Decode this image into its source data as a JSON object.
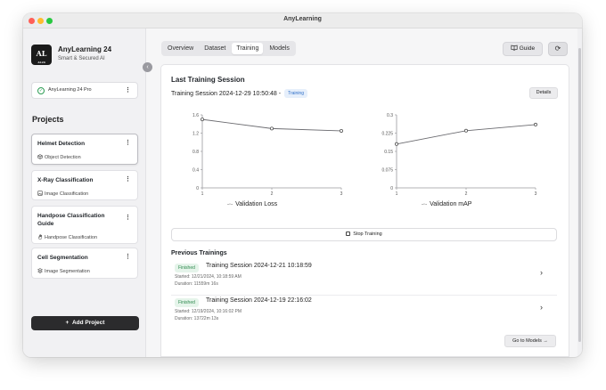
{
  "window": {
    "title": "AnyLearning"
  },
  "app": {
    "name": "AnyLearning 24",
    "tagline": "Smart & Secured AI",
    "logo_text": "AL",
    "logo_sub": "AL24"
  },
  "plan": {
    "label": "AnyLearning 24 Pro"
  },
  "sidebar": {
    "projects_title": "Projects",
    "projects": [
      {
        "name": "Helmet Detection",
        "type": "Object Detection",
        "icon": "cube-icon",
        "active": true
      },
      {
        "name": "X-Ray Classification",
        "type": "Image Classification",
        "icon": "image-icon",
        "active": false
      },
      {
        "name": "Handpose Classification Guide",
        "type": "Handpose Classification",
        "icon": "hand-icon",
        "active": false
      },
      {
        "name": "Cell Segmentation",
        "type": "Image Segmentation",
        "icon": "layers-icon",
        "active": false
      }
    ],
    "add_project_label": "Add Project"
  },
  "tabs": [
    {
      "label": "Overview",
      "active": false
    },
    {
      "label": "Dataset",
      "active": false
    },
    {
      "label": "Training",
      "active": true
    },
    {
      "label": "Models",
      "active": false
    }
  ],
  "toolbar": {
    "guide_label": "Guide"
  },
  "last_session": {
    "section_title": "Last Training Session",
    "session_label": "Training Session 2024-12-29 10:50:48 -",
    "status": "Training",
    "details_label": "Details"
  },
  "chart_data": [
    {
      "type": "line",
      "x": [
        1,
        2,
        3
      ],
      "values": [
        1.5,
        1.3,
        1.25
      ],
      "xticks": [
        "1",
        "2",
        "3"
      ],
      "yticks": [
        "0",
        "0.4",
        "0.8",
        "1.2",
        "1.6"
      ],
      "ylim": [
        0,
        1.6
      ],
      "legend": "Validation Loss"
    },
    {
      "type": "line",
      "x": [
        1,
        2,
        3
      ],
      "values": [
        0.18,
        0.235,
        0.26
      ],
      "xticks": [
        "1",
        "2",
        "3"
      ],
      "yticks": [
        "0",
        "0.075",
        "0.15",
        "0.225",
        "0.3"
      ],
      "ylim": [
        0,
        0.3
      ],
      "legend": "Validation mAP"
    }
  ],
  "stop_training_label": "Stop Training",
  "previous": {
    "title": "Previous Trainings",
    "items": [
      {
        "status": "Finished",
        "name": "Training Session 2024-12-21 10:18:59",
        "started": "Started: 12/21/2024, 10:18:59 AM",
        "duration": "Duration: 11559m 16s"
      },
      {
        "status": "Finished",
        "name": "Training Session 2024-12-19 22:16:02",
        "started": "Started: 12/19/2024, 10:16:02 PM",
        "duration": "Duration: 13722m 13s"
      }
    ],
    "goto_models_label": "Go to Models →"
  },
  "colors": {
    "accent": "#2f6fc8",
    "success": "#2e8a4e",
    "primary_button": "#2b2b2d"
  }
}
